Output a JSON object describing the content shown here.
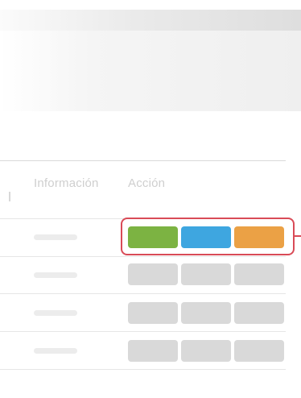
{
  "table": {
    "headers": {
      "info": "Información",
      "action": "Acción"
    },
    "rows": [
      {
        "highlighted": true,
        "buttons": [
          "green",
          "blue",
          "orange"
        ]
      },
      {
        "highlighted": false,
        "buttons": [
          "gray",
          "gray",
          "gray"
        ]
      },
      {
        "highlighted": false,
        "buttons": [
          "gray",
          "gray",
          "gray"
        ]
      },
      {
        "highlighted": false,
        "buttons": [
          "gray",
          "gray",
          "gray"
        ]
      }
    ]
  },
  "colors": {
    "green": "#7cb342",
    "blue": "#3ea6e0",
    "orange": "#eba145",
    "gray": "#d9d9d9",
    "highlight": "#d94b57"
  }
}
